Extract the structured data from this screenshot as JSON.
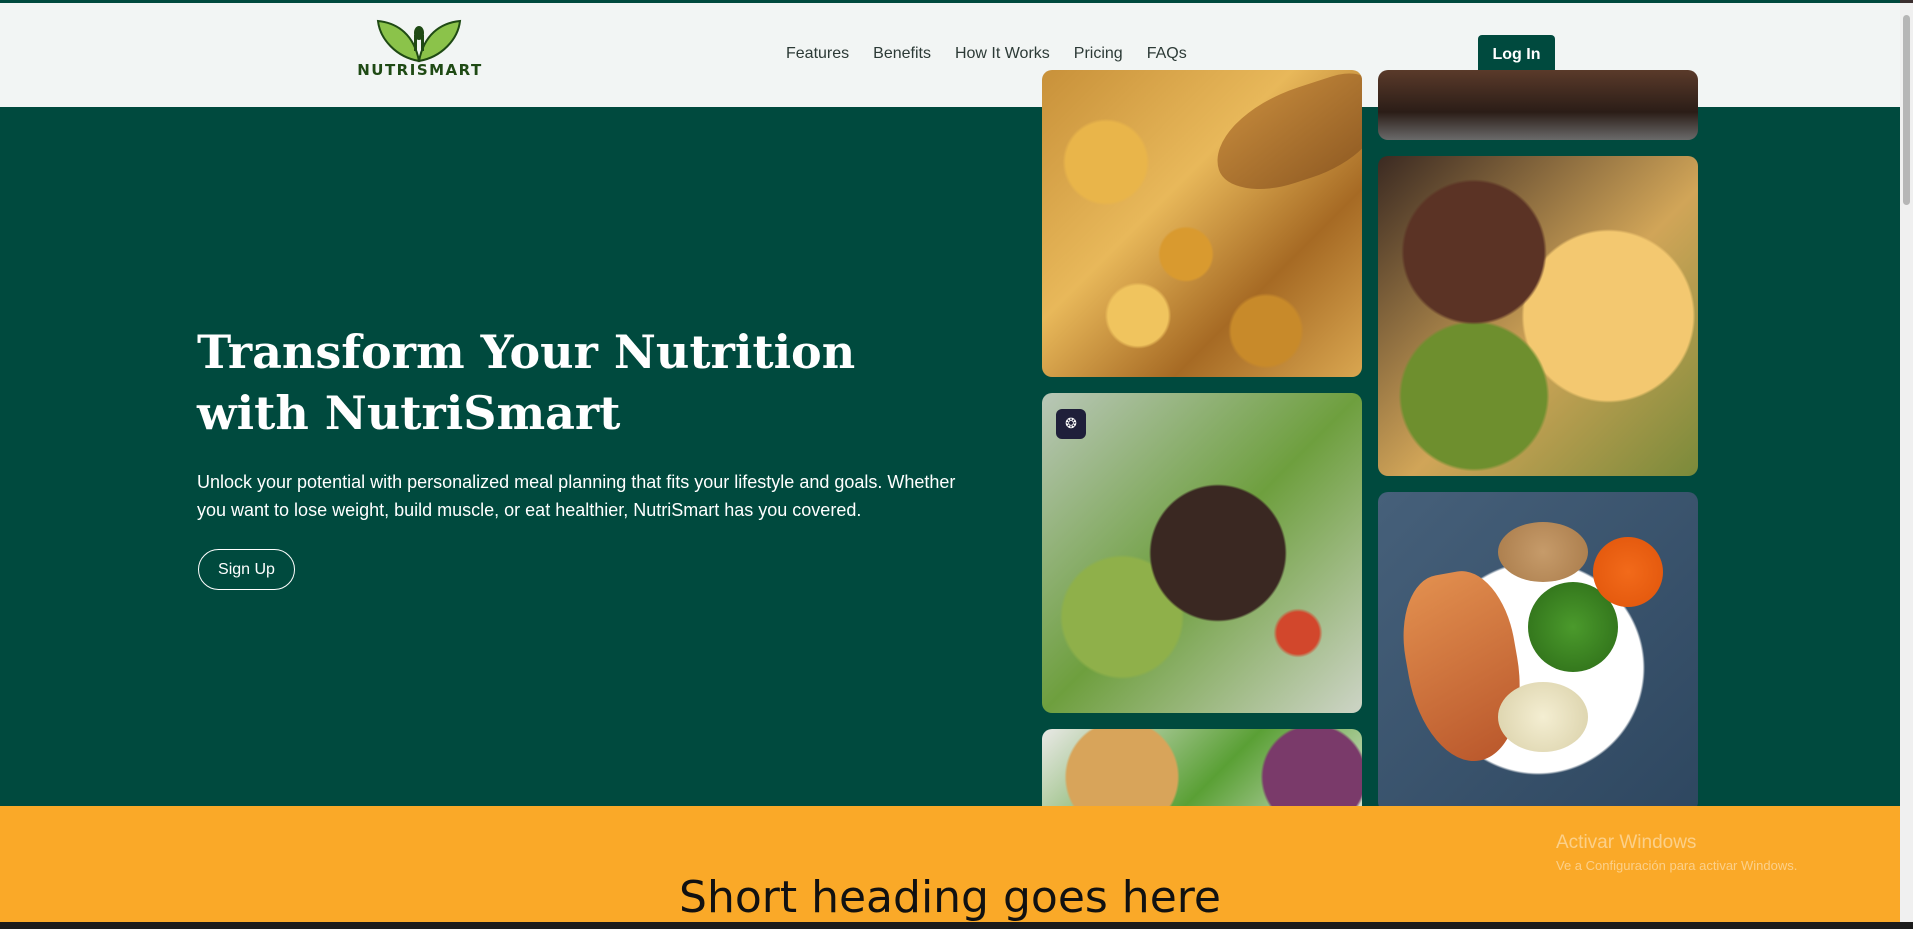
{
  "brand": {
    "name": "NUTRISMART",
    "leaf_color": "#8bc34a",
    "text_color": "#1f4a14"
  },
  "nav": {
    "items": [
      {
        "label": "Features"
      },
      {
        "label": "Benefits"
      },
      {
        "label": "How It Works"
      },
      {
        "label": "Pricing"
      },
      {
        "label": "FAQs"
      }
    ],
    "login_label": "Log In"
  },
  "hero": {
    "title": "Transform Your Nutrition with NutriSmart",
    "description": "Unlock your potential with personalized meal planning that fits your lifestyle and goals. Whether you want to lose weight, build muscle, or eat healthier, NutriSmart has you covered.",
    "signup_label": "Sign Up",
    "background_color": "#004a3e"
  },
  "gallery": {
    "images": [
      {
        "name": "roasted-potatoes"
      },
      {
        "name": "steak"
      },
      {
        "name": "steak-mac-broccoli"
      },
      {
        "name": "steak-salad"
      },
      {
        "name": "fish-plate"
      },
      {
        "name": "salad-bowl"
      }
    ]
  },
  "section": {
    "heading": "Short heading goes here",
    "background_color": "#faa928"
  },
  "os_watermark": {
    "line1": "Activar Windows",
    "line2": "Ve a Configuración para activar Windows."
  }
}
